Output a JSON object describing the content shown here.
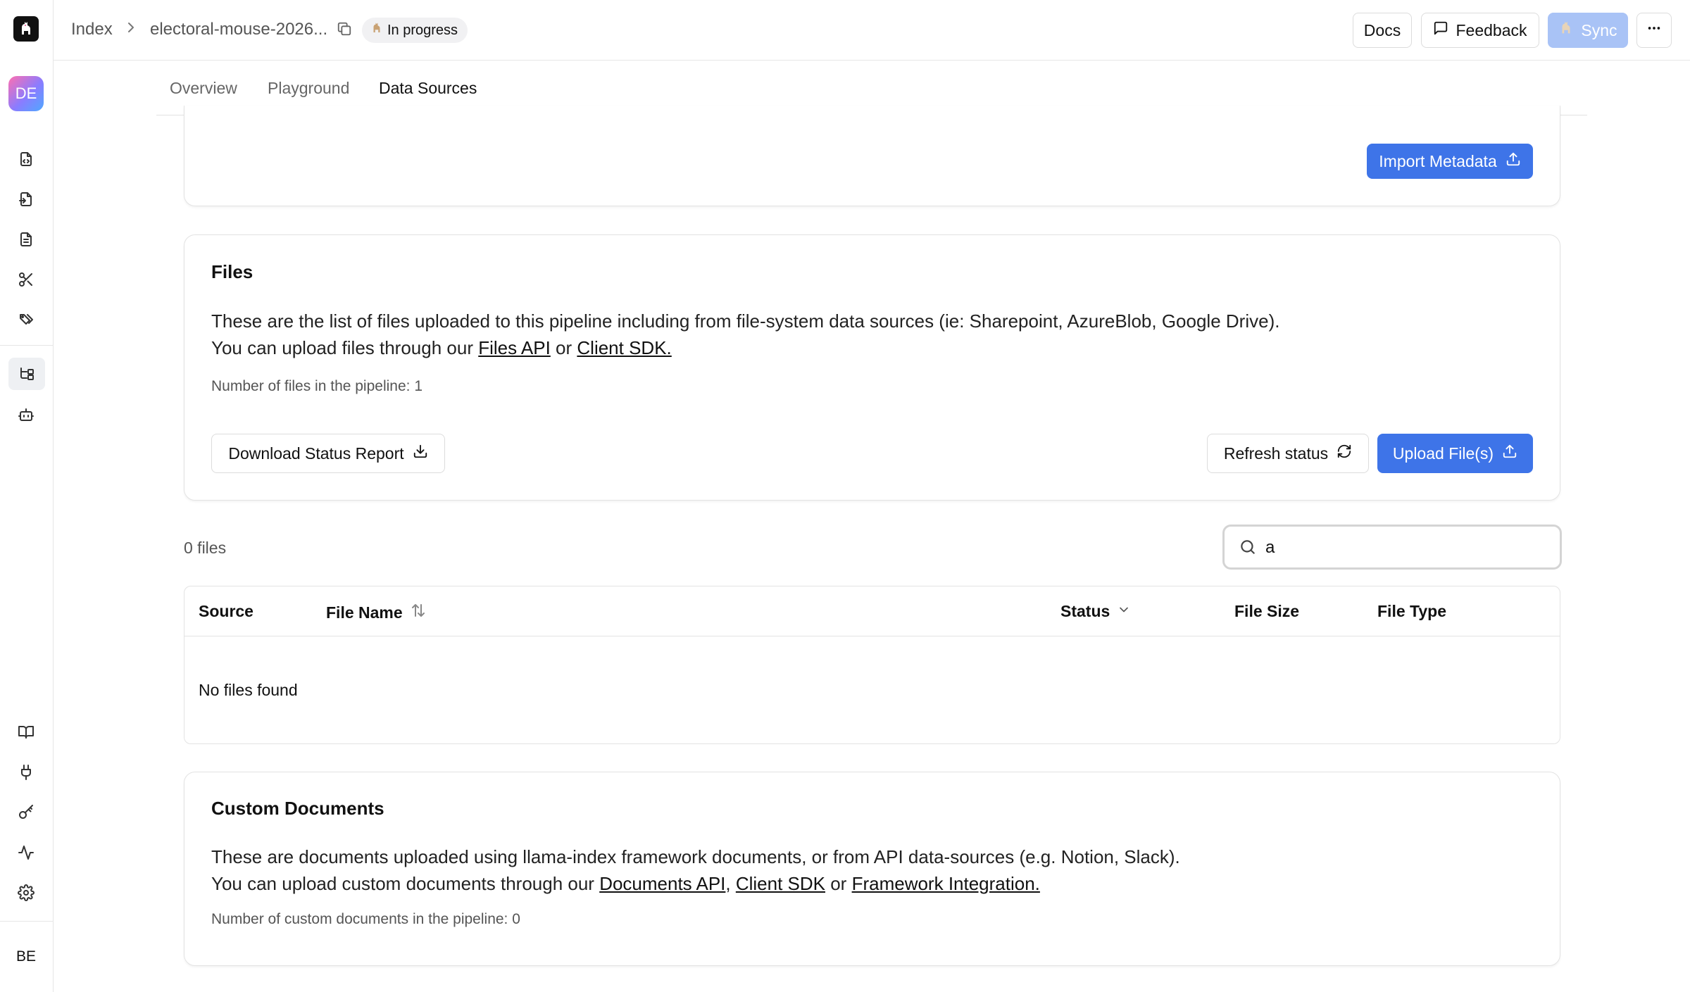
{
  "header": {
    "breadcrumb_root": "Index",
    "breadcrumb_current": "electoral-mouse-2026...",
    "status_badge": "In progress",
    "docs_label": "Docs",
    "feedback_label": "Feedback",
    "sync_label": "Sync"
  },
  "sidebar": {
    "workspace_initials": "DE",
    "user_initials": "BE",
    "icons": [
      "document-code-icon",
      "document-import-icon",
      "document-text-icon",
      "scissors-icon",
      "tags-icon",
      "pipeline-tree-icon",
      "robot-icon",
      "book-icon",
      "plug-icon",
      "key-icon",
      "activity-icon",
      "gear-icon"
    ]
  },
  "tabs": [
    {
      "label": "Overview",
      "active": false
    },
    {
      "label": "Playground",
      "active": false
    },
    {
      "label": "Data Sources",
      "active": true
    }
  ],
  "metadata_card": {
    "import_label": "Import Metadata"
  },
  "files_card": {
    "title": "Files",
    "desc_line1": "These are the list of files uploaded to this pipeline including from file-system data sources (ie: Sharepoint, AzureBlob, Google Drive).",
    "desc_line2_prefix": "You can upload files through our ",
    "files_api_link": "Files API",
    "or_text": " or ",
    "client_sdk_link": "Client SDK.",
    "count_text": "Number of files in the pipeline: 1",
    "download_label": "Download Status Report",
    "refresh_label": "Refresh status",
    "upload_label": "Upload File(s)"
  },
  "files_list": {
    "count_label": "0 files",
    "search_value": "a",
    "columns": {
      "source": "Source",
      "file_name": "File Name",
      "status": "Status",
      "file_size": "File Size",
      "file_type": "File Type"
    },
    "empty_text": "No files found"
  },
  "custom_docs_card": {
    "title": "Custom Documents",
    "desc_line1": "These are documents uploaded using llama-index framework documents, or from API data-sources (e.g. Notion, Slack).",
    "desc_line2_prefix": "You can upload custom documents through our ",
    "documents_api_link": "Documents API",
    "comma_text": ", ",
    "client_sdk_link": "Client SDK",
    "or_text": " or ",
    "framework_link": "Framework Integration.",
    "count_text": "Number of custom documents in the pipeline: 0"
  },
  "colors": {
    "primary": "#3e74e8",
    "sync_disabled": "#a9c3f6",
    "tab_underline": "#3b6fe6"
  }
}
